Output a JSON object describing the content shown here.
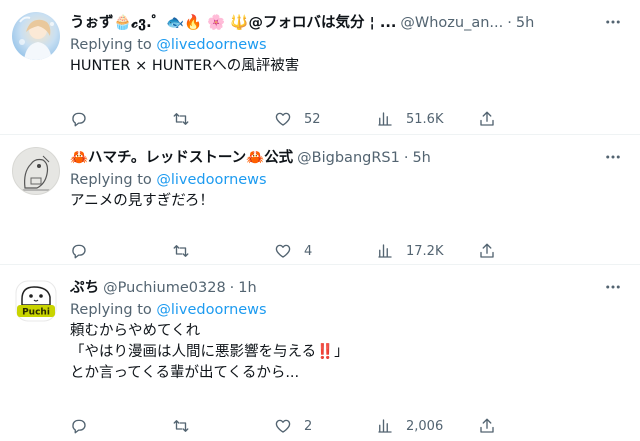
{
  "tweets": [
    {
      "display_name": "うぉず🧁𝓬ვ.゜🐟🔥 🌸 🔱@フォロバは気分 ¦ ...",
      "handle": "@Whozu_an...",
      "separator": "·",
      "time": "5h",
      "replying_prefix": "Replying to ",
      "replying_user": "@livedoornews",
      "text": "HUNTER × HUNTERへの風評被害",
      "reply_count": "",
      "retweet_count": "",
      "like_count": "52",
      "view_count": "51.6K"
    },
    {
      "display_name": "🦀ハマチ。レッドストーン🦀公式",
      "handle": "@BigbangRS1",
      "separator": "·",
      "time": "5h",
      "replying_prefix": "Replying to ",
      "replying_user": "@livedoornews",
      "text": "アニメの見すぎだろ！",
      "reply_count": "",
      "retweet_count": "",
      "like_count": "4",
      "view_count": "17.2K"
    },
    {
      "display_name": "ぷち",
      "handle": "@Puchiume0328",
      "separator": "·",
      "time": "1h",
      "replying_prefix": "Replying to ",
      "replying_user": "@livedoornews",
      "text": "頼むからやめてくれ\n「やはり漫画は人間に悪影響を与える‼️」\nとか言ってくる輩が出てくるから...",
      "reply_count": "",
      "retweet_count": "",
      "like_count": "2",
      "view_count": "2,006"
    }
  ],
  "avatar_labels": {
    "puchi": "Puchi"
  },
  "icons": {
    "more": "more-horizontal-icon",
    "reply": "reply-icon",
    "retweet": "retweet-icon",
    "like": "heart-icon",
    "views": "views-chart-icon",
    "share": "share-icon"
  },
  "colors": {
    "text": "#0f1419",
    "secondary": "#536471",
    "link": "#1d9bf0",
    "divider": "#eff3f4",
    "puchi_badge": "#c9d400"
  }
}
